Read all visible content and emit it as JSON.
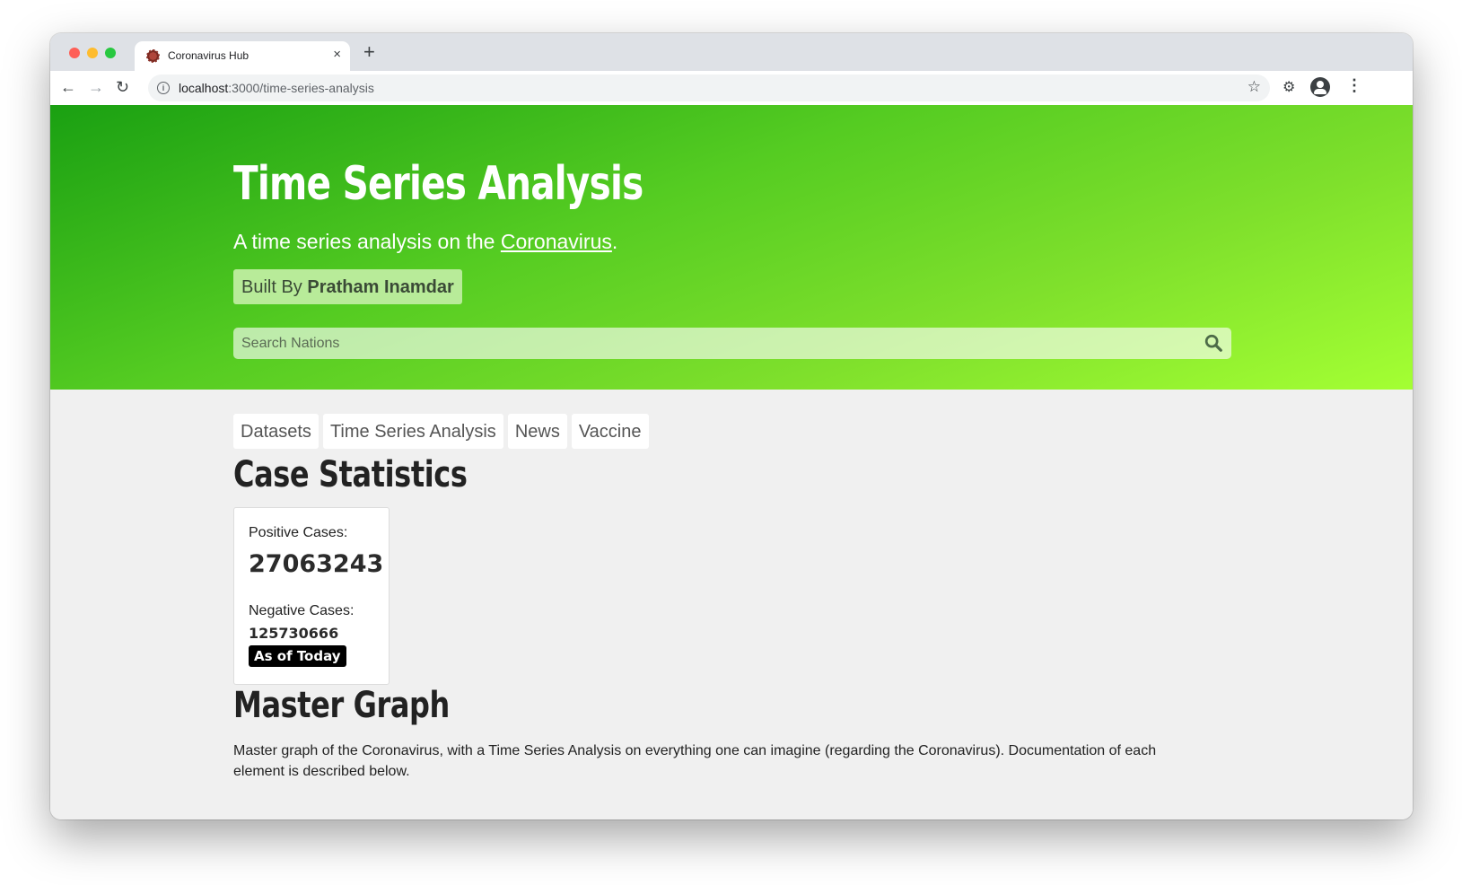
{
  "browser": {
    "tab_title": "Coronavirus Hub",
    "tab_close": "×",
    "new_tab": "+",
    "url_host": "localhost",
    "url_path": ":3000/time-series-analysis",
    "icons": [
      "back-icon",
      "forward-icon",
      "reload-icon",
      "info-icon",
      "star-icon",
      "extensions-icon",
      "profile-icon",
      "menu-icon"
    ]
  },
  "hero": {
    "title": "Time Series Analysis",
    "subtitle_prefix": "A time series analysis on the ",
    "subtitle_link": "Coronavirus",
    "subtitle_suffix": ".",
    "built_by_prefix": "Built By ",
    "built_by_name": "Pratham Inamdar",
    "search_placeholder": "Search Nations",
    "gradient_colors": [
      "#1aa012",
      "#a4ff33"
    ]
  },
  "nav_pills": [
    "Datasets",
    "Time Series Analysis",
    "News",
    "Vaccine"
  ],
  "case_statistics": {
    "heading": "Case Statistics",
    "positive_label": "Positive Cases:",
    "positive_value": "27063243",
    "negative_label": "Negative Cases:",
    "negative_value": "125730666",
    "badge": "As of Today"
  },
  "master_graph": {
    "heading": "Master Graph",
    "description": "Master graph of the Coronavirus, with a Time Series Analysis on everything one can imagine (regarding the Coronavirus). Documentation of each element is described below."
  }
}
